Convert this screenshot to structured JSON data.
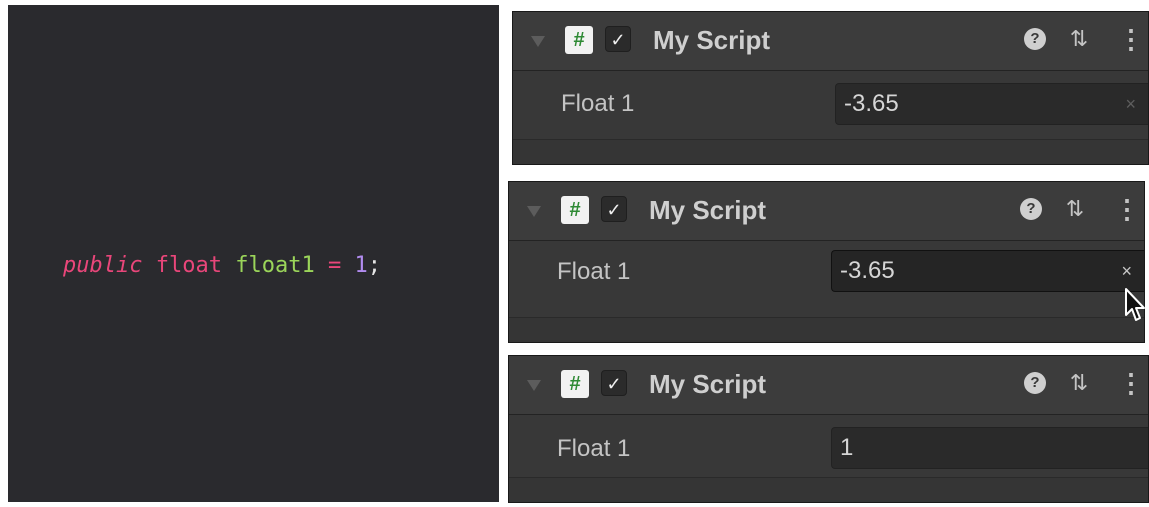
{
  "code": {
    "keyword_public": "public",
    "type": "float",
    "name": "float1",
    "operator": "=",
    "value": "1",
    "terminator": ";"
  },
  "inspectors": [
    {
      "title": "My Script",
      "icon_glyph": "#",
      "checkbox_glyph": "✓",
      "help_glyph": "?",
      "preset_glyph": "⇅",
      "menu_glyph": "⋮",
      "field_label": "Float 1",
      "field_value": "-3.65",
      "clear_glyph": "×"
    },
    {
      "title": "My Script",
      "icon_glyph": "#",
      "checkbox_glyph": "✓",
      "help_glyph": "?",
      "preset_glyph": "⇅",
      "menu_glyph": "⋮",
      "field_label": "Float 1",
      "field_value": "-3.65",
      "clear_glyph": "×"
    },
    {
      "title": "My Script",
      "icon_glyph": "#",
      "checkbox_glyph": "✓",
      "help_glyph": "?",
      "preset_glyph": "⇅",
      "menu_glyph": "⋮",
      "field_label": "Float 1",
      "field_value": "1",
      "clear_glyph": ""
    }
  ],
  "icons": {
    "foldout": "triangle-down-icon",
    "script": "csharp-script-icon",
    "checkbox": "checkmark-icon",
    "help": "help-icon",
    "preset": "preset-sliders-icon",
    "menu": "kebab-menu-icon",
    "clear": "clear-x-icon",
    "cursor": "mouse-pointer-icon"
  },
  "colors": {
    "keyword": "#e9467a",
    "identifier": "#9bd55a",
    "number": "#b28cf0",
    "panel_bg": "#383838",
    "code_bg": "#2a2a2e"
  }
}
